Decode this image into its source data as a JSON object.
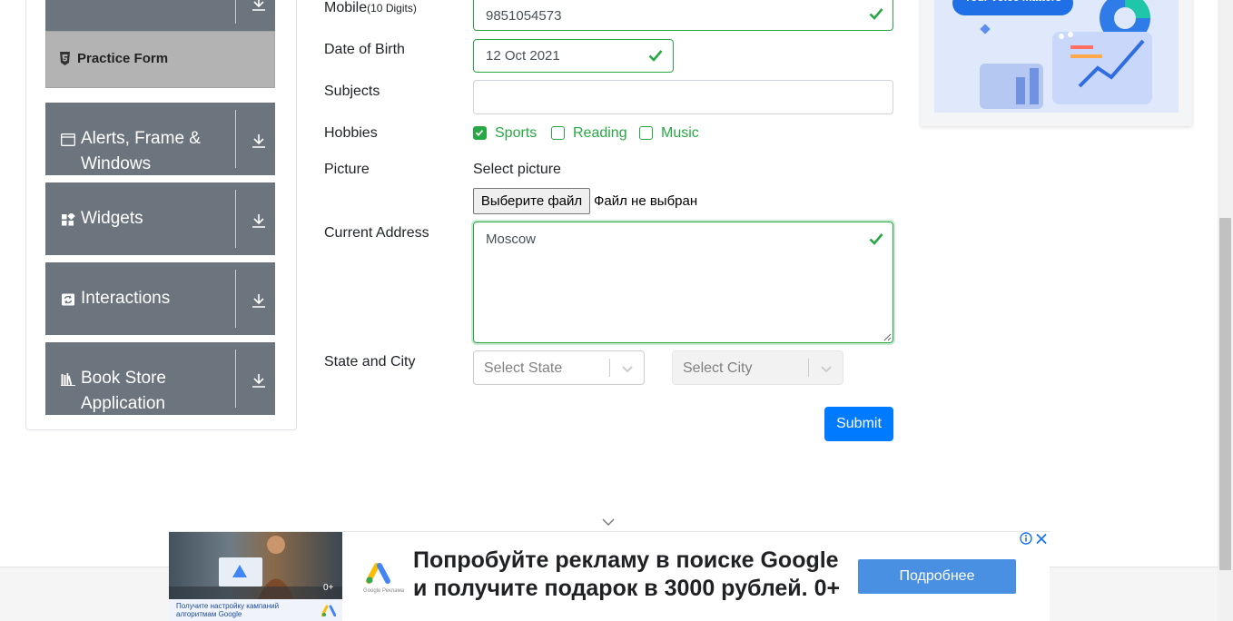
{
  "sidebar": {
    "active_item": {
      "label": "Practice Form",
      "icon": "html5-icon"
    },
    "groups": [
      {
        "label": "Alerts, Frame & Windows",
        "icon": "window-icon"
      },
      {
        "label": "Widgets",
        "icon": "widgets-icon"
      },
      {
        "label": "Interactions",
        "icon": "interactions-icon"
      },
      {
        "label": "Book Store Application",
        "icon": "bookshelf-icon"
      }
    ],
    "expand_icon": "download-arrow-icon"
  },
  "form": {
    "mobile": {
      "label": "Mobile",
      "hint": "(10 Digits)",
      "value": "9851054573"
    },
    "dob": {
      "label": "Date of Birth",
      "value": "12 Oct 2021"
    },
    "subjects": {
      "label": "Subjects",
      "value": ""
    },
    "hobbies": {
      "label": "Hobbies",
      "options": [
        {
          "label": "Sports",
          "checked": true
        },
        {
          "label": "Reading",
          "checked": false
        },
        {
          "label": "Music",
          "checked": false
        }
      ]
    },
    "picture": {
      "label": "Picture",
      "prompt": "Select picture",
      "button": "Выберите файл",
      "status": "Файл не выбран"
    },
    "address": {
      "label": "Current Address",
      "value": "Moscow"
    },
    "state_city": {
      "label": "State and City",
      "state_placeholder": "Select State",
      "city_placeholder": "Select City"
    },
    "submit": "Submit"
  },
  "right_ad": {
    "text": "Your voice matters"
  },
  "bottom_ad": {
    "headline_line1": "Попробуйте рекламу в поиске Google",
    "headline_line2": "и получите подарок в 3000 рублей. 0+",
    "cta": "Подробнее",
    "photo_caption": "Получите настройку кампаний алгоритмам Google",
    "age_badge": "0+",
    "logo_caption": "Google Реклама"
  },
  "colors": {
    "valid": "#28a745",
    "primary": "#007bff",
    "sidebar_group": "#6c757d",
    "active_item": "#b3b3b3",
    "ad_cta": "#4a90e2"
  }
}
